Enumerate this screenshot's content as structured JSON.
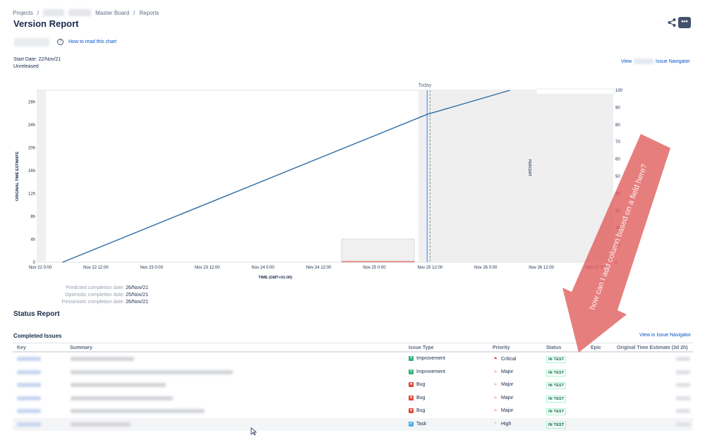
{
  "breadcrumb": {
    "projects": "Projects",
    "sep1": "/",
    "board": "Master Board",
    "sep2": "/",
    "reports": "Reports"
  },
  "header": {
    "title": "Version Report",
    "more_label": "•••"
  },
  "toolbar": {
    "help_icon": "?",
    "help_link": "How to read this chart"
  },
  "meta": {
    "start_date": "Start Date: 22/Nov/21",
    "status": "Unreleased",
    "view_prefix": "View",
    "view_suffix": "Issue Navigator"
  },
  "chart_data": {
    "type": "line",
    "ylabel": "ORIGINAL TIME ESTIMATE",
    "xlabel": "TIME (GMT+01:00)",
    "right_ylabel": "PERCENT",
    "today_label": "Today",
    "y_ticks": [
      "0",
      "4h",
      "8h",
      "12h",
      "16h",
      "20h",
      "24h",
      "28h"
    ],
    "y_ticks_hours": [
      0,
      4,
      8,
      12,
      16,
      20,
      24,
      28
    ],
    "right_ticks": [
      "0",
      "10",
      "20",
      "30",
      "40",
      "50",
      "60",
      "70",
      "80",
      "90",
      "100"
    ],
    "right_ticks_values": [
      0,
      10,
      20,
      30,
      40,
      50,
      60,
      70,
      80,
      90,
      100
    ],
    "x_ticks": [
      "Nov 22 0:00",
      "Nov 22 12:00",
      "Nov 23 0:00",
      "Nov 23 12:00",
      "Nov 24 0:00",
      "Nov 24 12:00",
      "Nov 25 0:00",
      "Nov 25 12:00",
      "Nov 26 0:00",
      "Nov 26 12:00",
      "Nov 27 0:00"
    ],
    "ylim_hours": [
      0,
      30
    ],
    "x_range_days": [
      0,
      5
    ],
    "series": [
      {
        "color": "#2e6da4",
        "x_days": [
          0.15,
          3.45,
          4.2
        ],
        "y_hours": [
          0,
          25.8,
          30
        ]
      }
    ],
    "today_x_days": 3.45,
    "accent": "#2e6da4"
  },
  "completion": {
    "predicted_label": "Predicted completion date:",
    "predicted_value": "26/Nov/21",
    "optimistic_label": "Optimistic completion date:",
    "optimistic_value": "25/Nov/21",
    "pessimistic_label": "Pessimistic completion date:",
    "pessimistic_value": "26/Nov/21"
  },
  "status_report": {
    "title": "Status Report",
    "completed_title": "Completed Issues",
    "navigator_link": "View in Issue Navigator",
    "columns": {
      "key": "Key",
      "summary": "Summary",
      "issue_type": "Issue Type",
      "priority": "Priority",
      "status": "Status",
      "epic": "Epic",
      "estimate": "Original Time Estimate (3d 2h)"
    },
    "rows": [
      {
        "type": "Improvement",
        "type_icon": "improvement-icon",
        "type_color": "#36b37e",
        "priority": "Critical",
        "priority_icon": "critical-priority-icon",
        "priority_color": "#de350b",
        "status": "IN TEST"
      },
      {
        "type": "Improvement",
        "type_icon": "improvement-icon",
        "type_color": "#36b37e",
        "priority": "Major",
        "priority_icon": "major-priority-icon",
        "priority_color": "#ff5630",
        "status": "IN TEST"
      },
      {
        "type": "Bug",
        "type_icon": "bug-icon",
        "type_color": "#e5493a",
        "priority": "Major",
        "priority_icon": "major-priority-icon",
        "priority_color": "#ff5630",
        "status": "IN TEST"
      },
      {
        "type": "Bug",
        "type_icon": "bug-icon",
        "type_color": "#e5493a",
        "priority": "Major",
        "priority_icon": "major-priority-icon",
        "priority_color": "#ff5630",
        "status": "IN TEST"
      },
      {
        "type": "Bug",
        "type_icon": "bug-icon",
        "type_color": "#e5493a",
        "priority": "Major",
        "priority_icon": "major-priority-icon",
        "priority_color": "#ff5630",
        "status": "IN TEST"
      },
      {
        "type": "Task",
        "type_icon": "task-icon",
        "type_color": "#4bade8",
        "priority": "High",
        "priority_icon": "high-priority-icon",
        "priority_color": "#ff7452",
        "status": "IN TEST"
      }
    ]
  },
  "annotation": {
    "text": "how can I add column based on a field here?",
    "color": "#e05a5a"
  }
}
